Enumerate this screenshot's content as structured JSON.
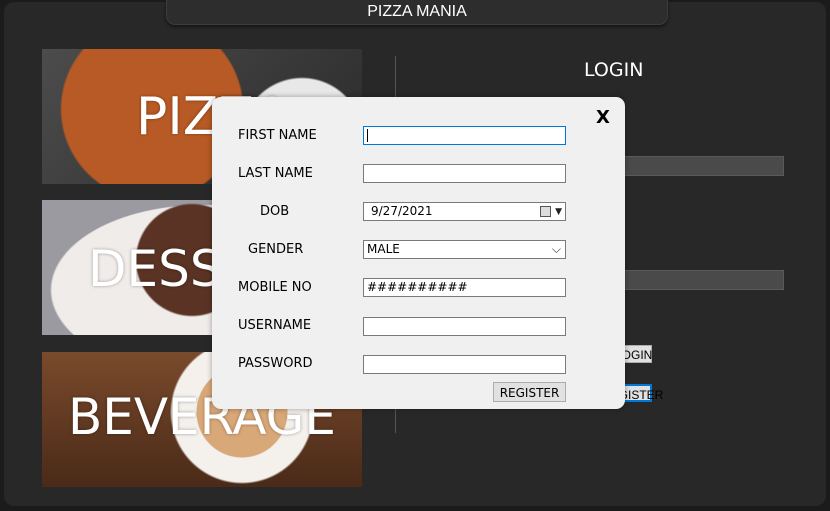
{
  "app": {
    "title": "PIZZA MANIA"
  },
  "tiles": {
    "pizza": "PIZZA",
    "dessert": "DESSERT",
    "beverage": "BEVERAGE"
  },
  "login": {
    "title": "LOGIN",
    "login_button": "LOGIN",
    "register_button": "REGISTER"
  },
  "register_dialog": {
    "close": "X",
    "labels": {
      "first_name": "FIRST NAME",
      "last_name": "LAST NAME",
      "dob": "DOB",
      "gender": "GENDER",
      "mobile": "MOBILE NO",
      "username": "USERNAME",
      "password": "PASSWORD"
    },
    "values": {
      "first_name": "",
      "last_name": "",
      "dob": "9/27/2021",
      "gender": "MALE",
      "mobile": "##########",
      "username": "",
      "password": ""
    },
    "register_button": "REGISTER"
  },
  "icons": {
    "calendar": "calendar-icon",
    "dropdown": "chevron-down-icon"
  },
  "colors": {
    "background": "#282828",
    "dialog": "#f0f0f0",
    "focus": "#0078d7"
  }
}
